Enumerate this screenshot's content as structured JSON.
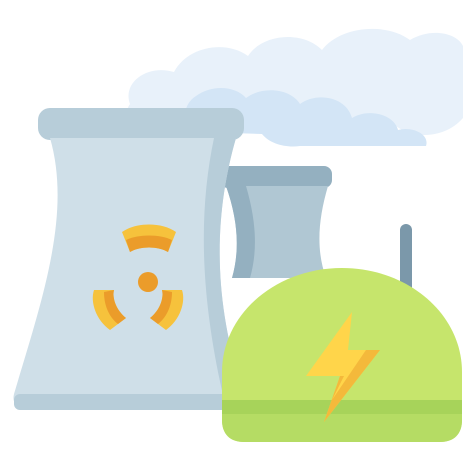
{
  "illustration": {
    "subject": "nuclear-power-plant-icon",
    "colors": {
      "cloud_light": "#e8f1fa",
      "cloud_mid": "#d3e5f6",
      "tower_front": "#cfdfe8",
      "tower_front_shade": "#b7cdd9",
      "tower_back": "#b0c7d3",
      "tower_back_shade": "#94b0c0",
      "radiation_yellow": "#f6c23c",
      "radiation_orange": "#eb9c2a",
      "dome_green": "#c6e56c",
      "dome_stripe": "#a7d35a",
      "antenna": "#7b98aa",
      "bolt_yellow": "#ffd54a",
      "bolt_shade": "#f4b93b"
    }
  }
}
